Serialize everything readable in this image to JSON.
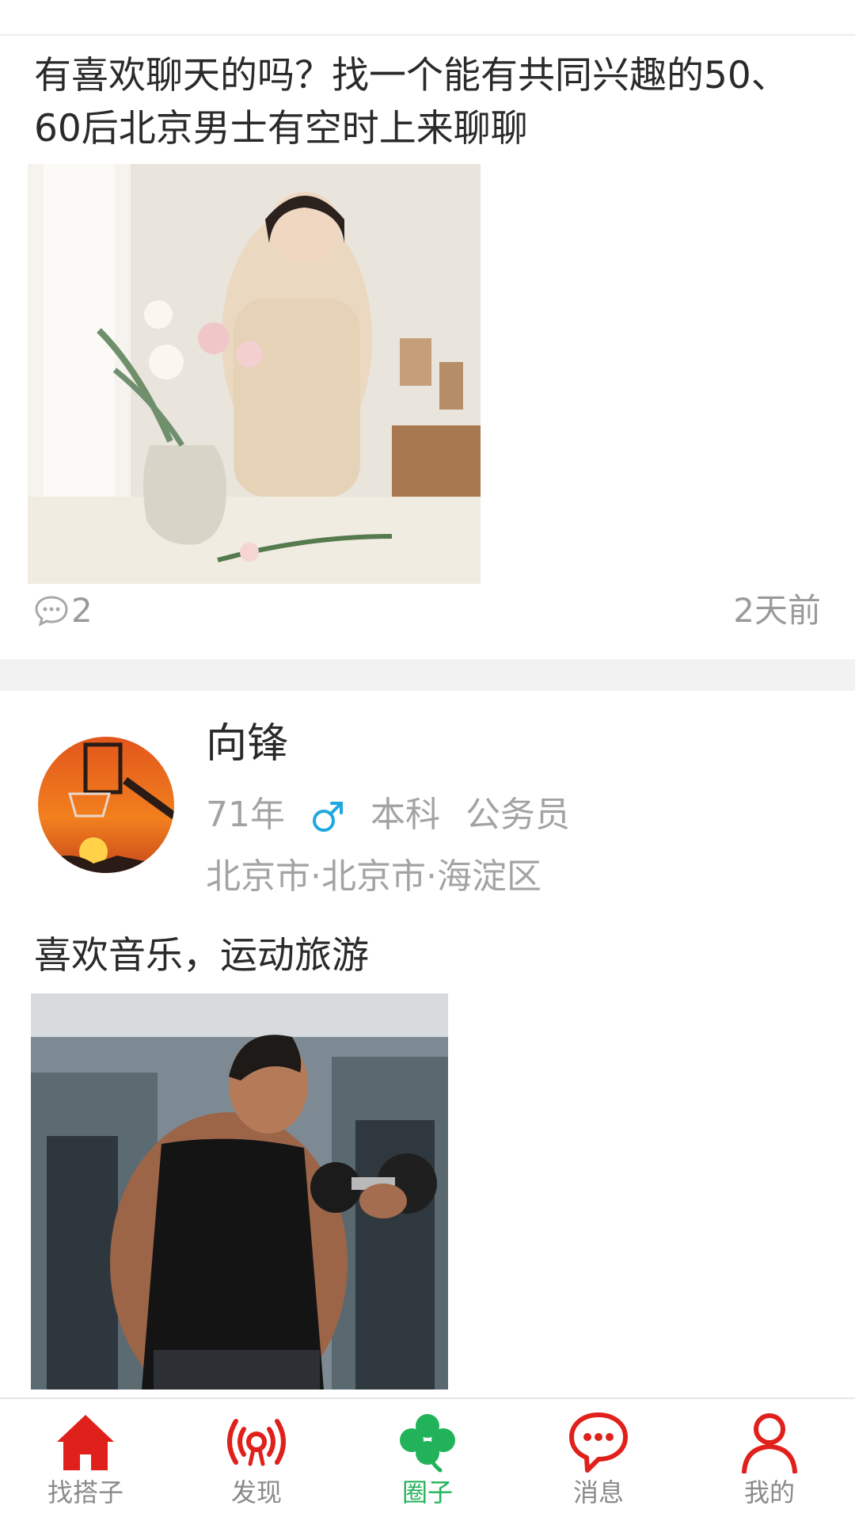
{
  "post1": {
    "title": "有喜欢聊天的吗？找一个能有共同兴趣的50、60后北京男士有空时上来聊聊",
    "comment_count": "2",
    "time_ago": "2天前"
  },
  "post2": {
    "user_name": "向锋",
    "birth_year": "71年",
    "gender_icon": "male-icon",
    "education": "本科",
    "occupation": "公务员",
    "location": "北京市·北京市·海淀区",
    "text": "喜欢音乐，运动旅游"
  },
  "tabbar": {
    "active_color": "#22b35a",
    "icon_color": "#e0201b",
    "tabs": [
      {
        "label": "找搭子",
        "icon": "home-icon"
      },
      {
        "label": "发现",
        "icon": "broadcast-icon"
      },
      {
        "label": "圈子",
        "icon": "clover-icon"
      },
      {
        "label": "消息",
        "icon": "chat-bubble-icon"
      },
      {
        "label": "我的",
        "icon": "person-icon"
      }
    ],
    "active_index": 2
  }
}
